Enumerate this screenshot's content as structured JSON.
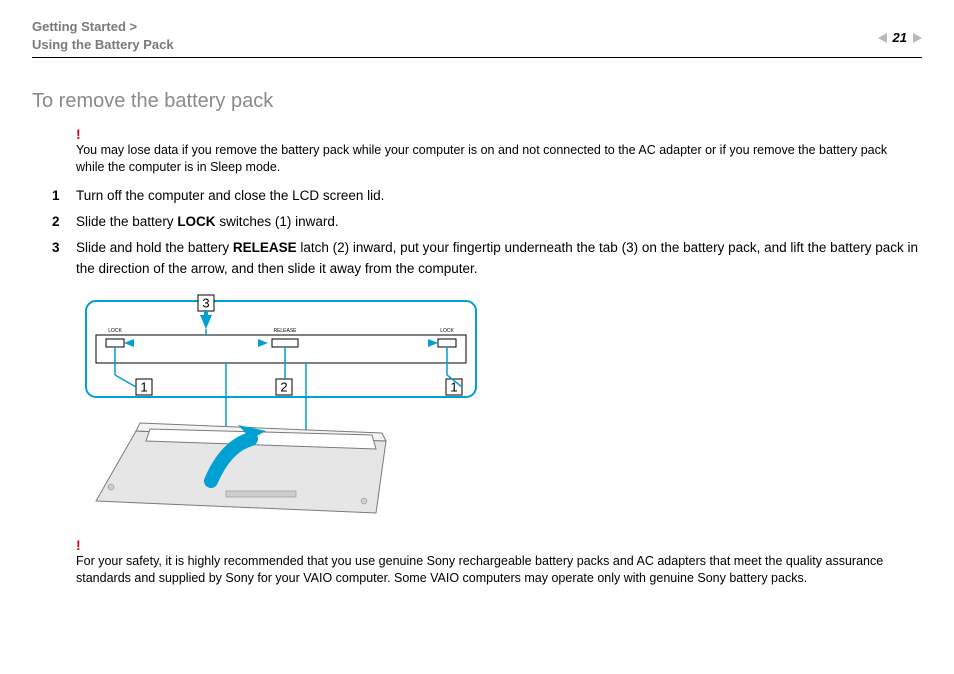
{
  "header": {
    "breadcrumb_line1": "Getting Started >",
    "breadcrumb_line2": "Using the Battery Pack",
    "page_number": "21"
  },
  "title": "To remove the battery pack",
  "warning_mark": "!",
  "note_top": "You may lose data if you remove the battery pack while your computer is on and not connected to the AC adapter or if you remove the battery pack while the computer is in Sleep mode.",
  "steps": [
    {
      "n": "1",
      "text_before": "Turn off the computer and close the LCD screen lid.",
      "bold": "",
      "text_after": ""
    },
    {
      "n": "2",
      "text_before": "Slide the battery ",
      "bold": "LOCK",
      "text_after": " switches (1) inward."
    },
    {
      "n": "3",
      "text_before": "Slide and hold the battery ",
      "bold": "RELEASE",
      "text_after": " latch (2) inward, put your fingertip underneath the tab (3) on the battery pack, and lift the battery pack in the direction of the arrow, and then slide it away from the computer."
    }
  ],
  "diagram": {
    "callouts": {
      "c1": "1",
      "c2": "2",
      "c3": "3"
    },
    "labels": {
      "lock": "LOCK",
      "release": "RELEASE"
    }
  },
  "note_bottom": "For your safety, it is highly recommended that you use genuine Sony rechargeable battery packs and AC adapters that meet the quality assurance standards and supplied by Sony for your VAIO computer. Some VAIO computers may operate only with genuine Sony battery packs."
}
